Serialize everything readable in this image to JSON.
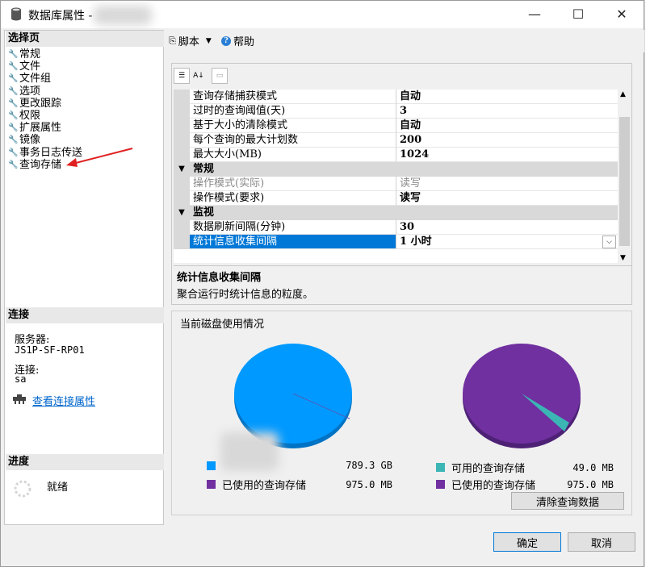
{
  "window": {
    "title": "数据库属性 -",
    "minimize": "—",
    "maximize": "☐",
    "close": "✕"
  },
  "left": {
    "select_page_header": "选择页",
    "pages": [
      "常规",
      "文件",
      "文件组",
      "选项",
      "更改跟踪",
      "权限",
      "扩展属性",
      "镜像",
      "事务日志传送",
      "查询存储"
    ],
    "connection_header": "连接",
    "server_label": "服务器:",
    "server_value": "JS1P-SF-RP01",
    "connection_label": "连接:",
    "connection_value": "sa",
    "view_connection_link": "查看连接属性",
    "progress_header": "进度",
    "progress_status": "就绪"
  },
  "toolbar": {
    "script_label": "脚本",
    "help_label": "帮助"
  },
  "grid": {
    "rows": [
      {
        "name": "查询存储捕获模式",
        "value": "自动"
      },
      {
        "name": "过时的查询阈值(天)",
        "value": "3"
      },
      {
        "name": "基于大小的清除模式",
        "value": "自动"
      },
      {
        "name": "每个查询的最大计划数",
        "value": "200"
      },
      {
        "name": "最大大小(MB)",
        "value": "1024"
      }
    ],
    "category_general": "常规",
    "general_rows": [
      {
        "name": "操作模式(实际)",
        "value": "读写"
      },
      {
        "name": "操作模式(要求)",
        "value": "读写"
      }
    ],
    "category_monitor": "监视",
    "monitor_rows": [
      {
        "name": "数据刷新间隔(分钟)",
        "value": "30"
      },
      {
        "name": "统计信息收集间隔",
        "value": "1 小时"
      }
    ]
  },
  "description": {
    "title": "统计信息收集间隔",
    "text": "聚合运行时统计信息的粒度。"
  },
  "disk": {
    "header": "当前磁盘使用情况",
    "left_legend": [
      {
        "label": "",
        "value": "789.3 GB",
        "color": "#0099ff"
      },
      {
        "label": "已使用的查询存储",
        "value": "975.0 MB",
        "color": "#7030a0"
      }
    ],
    "right_legend": [
      {
        "label": "可用的查询存储",
        "value": "49.0 MB",
        "color": "#3cb5b5"
      },
      {
        "label": "已使用的查询存储",
        "value": "975.0 MB",
        "color": "#7030a0"
      }
    ],
    "clear_button": "清除查询数据"
  },
  "footer": {
    "ok": "确定",
    "cancel": "取消"
  }
}
